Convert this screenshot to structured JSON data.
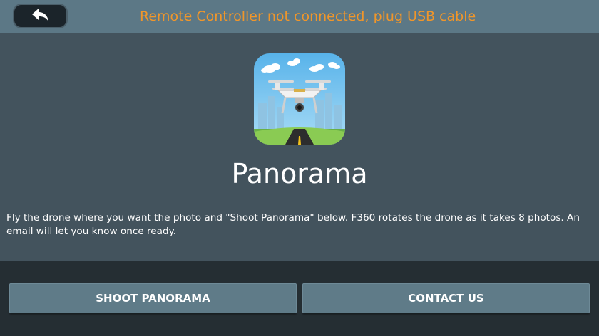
{
  "header": {
    "back_icon": "back-arrow-icon",
    "status_message": "Remote Controller not connected, plug USB cable",
    "status_color": "#f0962a"
  },
  "main": {
    "app_icon": "drone-icon",
    "title": "Panorama",
    "description": "Fly the drone where you want the photo and \"Shoot Panorama\" below. F360 rotates the drone as it takes 8 photos. An email will let you know once ready."
  },
  "actions": {
    "shoot_label": "SHOOT PANORAMA",
    "contact_label": "CONTACT US"
  }
}
